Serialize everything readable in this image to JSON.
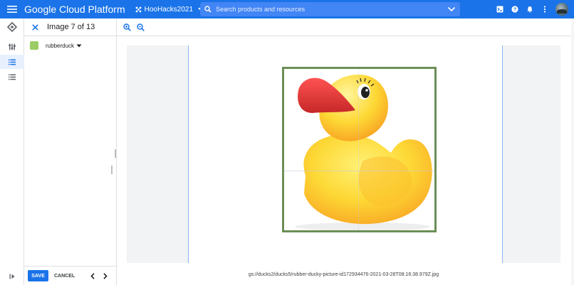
{
  "header": {
    "brand": "Google Cloud Platform",
    "project": "HooHacks2021",
    "search_placeholder": "Search products and resources"
  },
  "panel": {
    "title": "Image 7 of 13",
    "label": {
      "name": "rubberduck",
      "color": "#9ccc65"
    }
  },
  "footer": {
    "save_label": "SAVE",
    "cancel_label": "CANCEL"
  },
  "image": {
    "path": "gs://ducks2/ducks5/rubber-ducky-picture-id172934476-2021-03-28T08:16:38.979Z.jpg",
    "box_color": "#6b8e57"
  },
  "colors": {
    "accent": "#1a73e8"
  }
}
